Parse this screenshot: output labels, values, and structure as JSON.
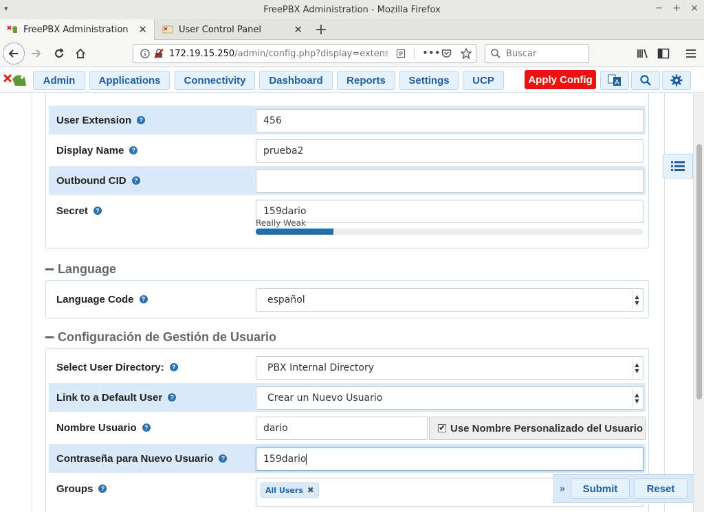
{
  "window": {
    "title": "FreePBX Administration - Mozilla Firefox"
  },
  "tabs": [
    {
      "label": "FreePBX Administration",
      "active": true
    },
    {
      "label": "User Control Panel",
      "active": false
    }
  ],
  "urlbar": {
    "host": "172.19.15.250",
    "path": "/admin/config.php?display=extensions"
  },
  "searchbar": {
    "placeholder": "Buscar"
  },
  "pbxnav": {
    "items": [
      "Admin",
      "Applications",
      "Connectivity",
      "Dashboard",
      "Reports",
      "Settings",
      "UCP"
    ],
    "apply_label": "Apply Config"
  },
  "general": {
    "user_extension": {
      "label": "User Extension",
      "value": "456"
    },
    "display_name": {
      "label": "Display Name",
      "value": "prueba2"
    },
    "outbound_cid": {
      "label": "Outbound CID",
      "value": ""
    },
    "secret": {
      "label": "Secret",
      "value": "159dario",
      "strength_label": "Really Weak",
      "strength": 0.2
    }
  },
  "language": {
    "title": "Language",
    "code": {
      "label": "Language Code",
      "value": "español"
    }
  },
  "user_mgmt": {
    "title": "Configuración de Gestión de Usuario",
    "directory": {
      "label": "Select User Directory:",
      "value": "PBX Internal Directory"
    },
    "default_user": {
      "label": "Link to a Default User",
      "value": "Crear un Nuevo Usuario"
    },
    "username": {
      "label": "Nombre Usuario",
      "value": "dario",
      "custom_label": "Use Nombre Personalizado del Usuario",
      "custom_checked": true
    },
    "password": {
      "label": "Contraseña para Nuevo Usuario",
      "value": "159dario"
    },
    "groups": {
      "label": "Groups",
      "tag": "All Users"
    }
  },
  "actions": {
    "submit": "Submit",
    "reset": "Reset"
  },
  "colors": {
    "accent": "#1f5f9e",
    "apply": "#ee1111",
    "row_shade": "#daeaf8",
    "strength": "#1f6fb0"
  }
}
